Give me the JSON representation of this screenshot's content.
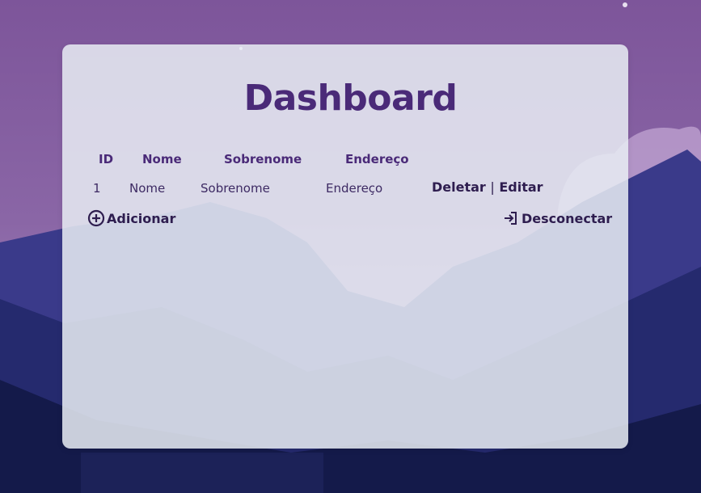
{
  "page": {
    "title": "Dashboard"
  },
  "table": {
    "headers": [
      "ID",
      "Nome",
      "Sobrenome",
      "Endereço"
    ],
    "rows": [
      {
        "id": "1",
        "nome": "Nome",
        "sobrenome": "Sobrenome",
        "endereco": "Endereço"
      }
    ]
  },
  "row_actions": {
    "delete_label": "Deletar",
    "separator": "|",
    "edit_label": "Editar"
  },
  "buttons": {
    "add_label": "Adicionar",
    "logout_label": "Desconectar"
  },
  "icons": {
    "add": "plus-circle-icon",
    "logout": "sign-in-arrow-icon"
  },
  "colors": {
    "title": "#4a2a78",
    "text": "#2e1d4f",
    "card": "#e8ecf3",
    "sky_top": "#7a4f98",
    "mountain": "#2e2f78"
  }
}
